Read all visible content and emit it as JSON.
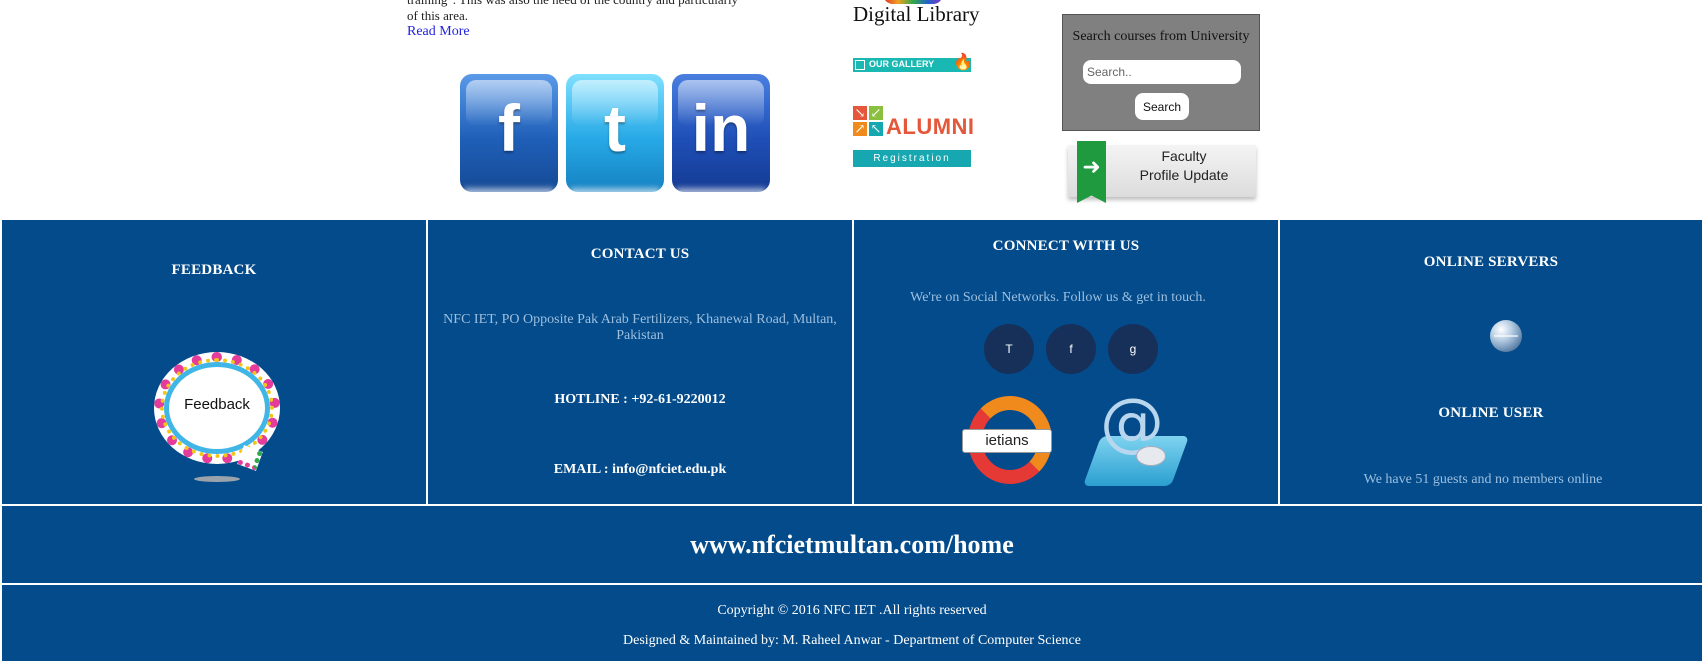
{
  "about": {
    "line1": "training\". This was also the need of the country and particularly",
    "line2": "of this area.",
    "read_more": "Read More"
  },
  "social_big": {
    "facebook_glyph": "f",
    "twitter_glyph": "t",
    "linkedin_glyph": "in",
    "facebook_color": "#1f5fb8",
    "twitter_color": "#27a9e6",
    "linkedin_color": "#1e4fb7"
  },
  "quick_links": {
    "digital_library": "Digital Library",
    "gallery": "OUR GALLERY",
    "alumni_title": "ALUMNI",
    "alumni_sub": "Registration"
  },
  "course_search": {
    "label": "Search courses from University",
    "placeholder": "Search..",
    "button": "Search"
  },
  "faculty": {
    "line1": "Faculty",
    "line2": "Profile Update"
  },
  "footer": {
    "panel_color": "#034b8a",
    "feedback": {
      "title": "FEEDBACK",
      "art_word": "Feedback"
    },
    "contact": {
      "title": "CONTACT US",
      "address": "NFC IET, PO Opposite Pak Arab Fertilizers, Khanewal Road, Multan, Pakistan",
      "hotline": "HOTLINE : +92-61-9220012",
      "email": "EMAIL : info@nfciet.edu.pk"
    },
    "connect": {
      "title": "CONNECT WITH US",
      "tagline": "We're on Social Networks. Follow us & get in touch.",
      "buttons": [
        "T",
        "f",
        "g"
      ],
      "ietians_label": "ietians"
    },
    "online": {
      "servers_title": "ONLINE SERVERS",
      "user_title": "ONLINE USER",
      "user_text": "We have 51 guests and no members online"
    },
    "url": "www.nfcietmultan.com/home",
    "copyright": "Copyright © 2016 NFC IET .All rights reserved",
    "designed_by": "Designed & Maintained by: M. Raheel Anwar - Department of Computer Science"
  },
  "icons": [
    "facebook-icon",
    "twitter-icon",
    "linkedin-icon",
    "gallery-icon",
    "flame-icon",
    "alumni-arrows-icon",
    "bookmark-arrow-icon",
    "feedback-bubble-icon",
    "globe-icon",
    "email-at-icon",
    "mouse-icon"
  ]
}
